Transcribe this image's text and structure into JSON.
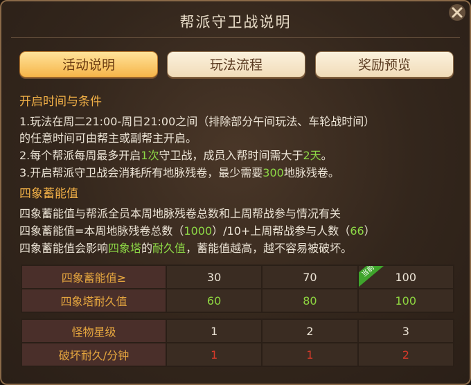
{
  "window": {
    "title": "帮派守卫战说明",
    "close_icon": "close-x-icon"
  },
  "tabs": [
    {
      "label": "活动说明",
      "active": true
    },
    {
      "label": "玩法流程",
      "active": false
    },
    {
      "label": "奖励预览",
      "active": false
    }
  ],
  "section1": {
    "heading": "开启时间与条件",
    "line1": "1.玩法在周二21:00-周日21:00之间（排除部分午间玩法、车轮战时间）",
    "line2": "的任意时间可由帮主或副帮主开启。",
    "line3_a": "2.每个帮派每周最多开启",
    "line3_b": "1次",
    "line3_c": "守卫战，成员入帮时间需大于",
    "line3_d": "2天",
    "line3_e": "。",
    "line4_a": "3.开启帮派守卫战会消耗所有地脉残卷，最少需要",
    "line4_b": "300",
    "line4_c": "地脉残卷。"
  },
  "section2": {
    "heading": "四象蓄能值",
    "line1": "四象蓄能值与帮派全员本周地脉残卷总数和上周帮战参与情况有关",
    "line2_a": "四象蓄能值=本周地脉残卷总数（",
    "line2_b": "1000",
    "line2_c": "）/10+上周帮战参与人数（",
    "line2_d": "66",
    "line2_e": "）",
    "line3_a": "四象蓄能值会影响",
    "line3_b": "四象塔",
    "line3_c": "的",
    "line3_d": "耐久值",
    "line3_e": "，蓄能值越高，越不容易被破坏。"
  },
  "table1": {
    "row1_label": "四象蓄能值≥",
    "row1_values": [
      "30",
      "70",
      "100"
    ],
    "row2_label": "四象塔耐久值",
    "row2_values": [
      "60",
      "80",
      "100"
    ],
    "current_badge": "当前"
  },
  "table2": {
    "row1_label": "怪物星级",
    "row1_values": [
      "1",
      "2",
      "3"
    ],
    "row2_label": "破坏耐久/分钟",
    "row2_values": [
      "1",
      "1",
      "2"
    ]
  },
  "colors": {
    "accent": "#f1b047",
    "highlight": "#8dd846",
    "damage": "#d83a2a"
  }
}
